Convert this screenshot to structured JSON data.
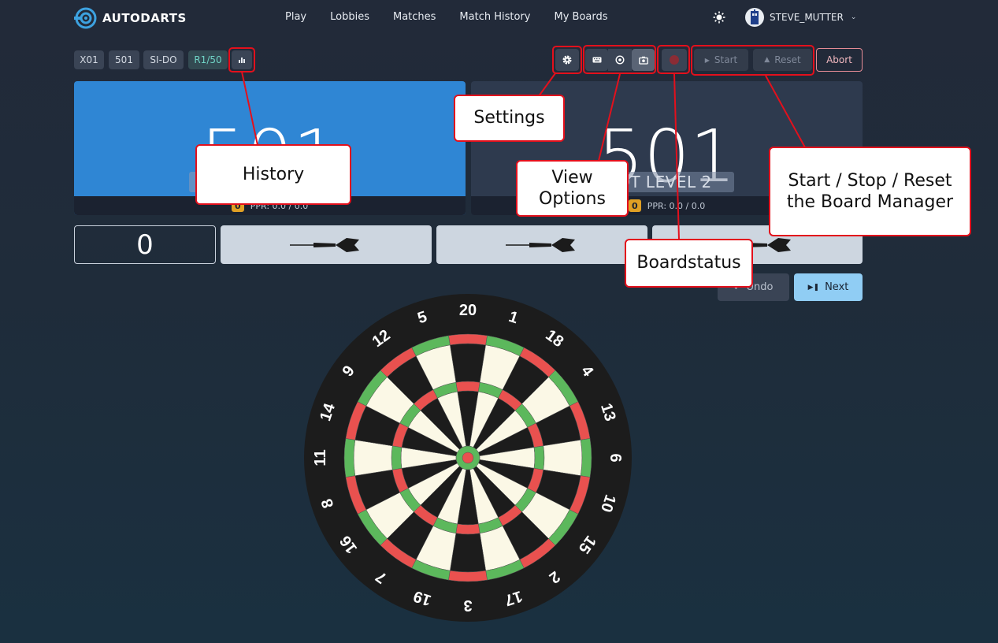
{
  "header": {
    "brand": "AUTODARTS",
    "nav": [
      "Play",
      "Lobbies",
      "Matches",
      "Match History",
      "My Boards"
    ],
    "username": "STEVE_MUTTER"
  },
  "toolbar": {
    "tags": [
      "X01",
      "501",
      "SI-DO",
      "R1/50"
    ],
    "start_label": "Start",
    "reset_label": "Reset",
    "abort_label": "Abort"
  },
  "players": [
    {
      "score": "501",
      "ppr_badge": "0",
      "ppr": "PPR: 0.0 / 0.0",
      "active": true
    },
    {
      "score": "501",
      "name": "BOT LEVEL 2",
      "ppr_badge": "0",
      "ppr": "PPR: 0.0 / 0.0",
      "active": false
    }
  ],
  "turn": {
    "total": "0"
  },
  "actions": {
    "undo_label": "Undo",
    "next_label": "Next"
  },
  "dartboard": {
    "numbers": [
      "20",
      "1",
      "18",
      "4",
      "13",
      "6",
      "10",
      "15",
      "2",
      "17",
      "3",
      "19",
      "7",
      "16",
      "8",
      "11",
      "14",
      "9",
      "12",
      "5"
    ]
  },
  "annotations": {
    "history": "History",
    "settings": "Settings",
    "view_options_1": "View",
    "view_options_2": "Options",
    "boardstatus": "Boardstatus",
    "board_manager_1": "Start / Stop / Reset",
    "board_manager_2": "the Board Manager"
  },
  "colors": {
    "active_card": "#2f86d4",
    "inactive_card": "#2e3a4e",
    "board_red": "#e9514f",
    "board_green": "#5cb85c",
    "board_cream": "#fbf8e6",
    "board_black": "#1c1c1c",
    "annotation_red": "#e3101c"
  }
}
